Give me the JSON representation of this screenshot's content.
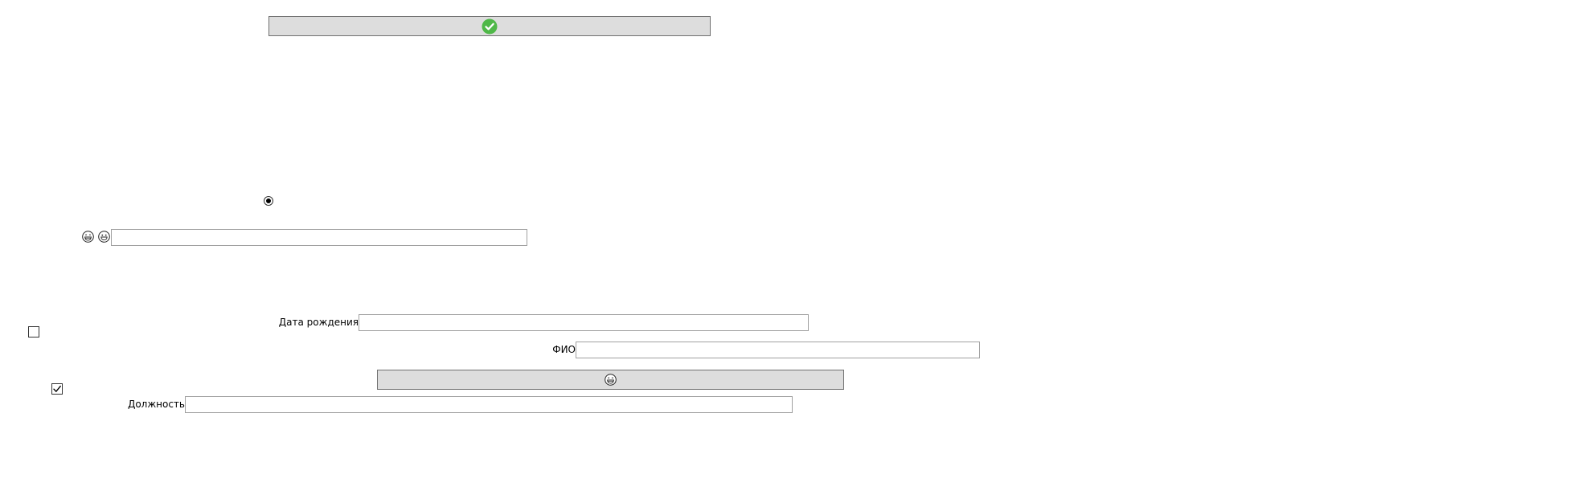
{
  "buttons": {
    "top": {
      "icon": "green-check-circle-icon",
      "accent": "#4fb848"
    },
    "middle": {
      "icon": "grinning-smiley-icon"
    }
  },
  "radio": {
    "checked": true
  },
  "emoji_row": {
    "icons": [
      "grinning-smiley-icon",
      "smiley-face-icon"
    ],
    "input": {
      "value": "",
      "placeholder": ""
    }
  },
  "fields": {
    "birth_date": {
      "label": "Дата рождения",
      "value": ""
    },
    "full_name": {
      "label": "ФИО",
      "value": ""
    },
    "position": {
      "label": "Должность",
      "value": ""
    }
  },
  "checkboxes": {
    "first": {
      "checked": false
    },
    "second": {
      "checked": true
    }
  },
  "colors": {
    "button_bg": "#dddddd",
    "button_border": "#707070",
    "field_border": "#a0a0a0",
    "check_green": "#4fb848"
  }
}
